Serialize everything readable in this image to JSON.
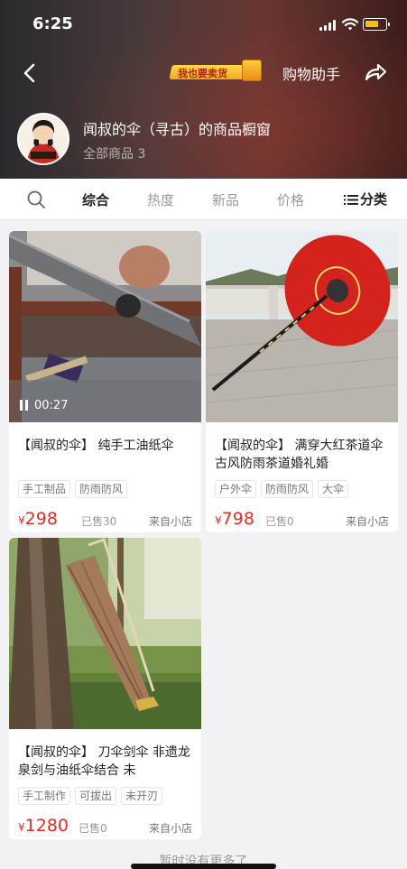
{
  "status_bar": {
    "time": "6:25"
  },
  "nav": {
    "sell_badge": "我也要卖货",
    "assistant": "购物助手"
  },
  "shop": {
    "name": "闻叔的伞（寻古）的商品橱窗",
    "count_label": "全部商品 3",
    "avatar_text": "闻叔的伞"
  },
  "tabs": [
    {
      "label": "综合",
      "active": true
    },
    {
      "label": "热度",
      "active": false
    },
    {
      "label": "新品",
      "active": false
    },
    {
      "label": "价格",
      "active": false
    }
  ],
  "category_label": "分类",
  "products": [
    {
      "title": "【闻叔的伞】 纯手工油纸伞",
      "tags": [
        "手工制品",
        "防雨防风"
      ],
      "currency": "¥",
      "price": "298",
      "sold": "已售30",
      "source": "来自小店",
      "video_duration": "00:27"
    },
    {
      "title": "【闻叔的伞】 满穿大红茶道伞 古风防雨茶道婚礼婚",
      "tags": [
        "户外伞",
        "防雨防风",
        "大伞"
      ],
      "currency": "¥",
      "price": "798",
      "sold": "已售0",
      "source": "来自小店"
    },
    {
      "title": "【闻叔的伞】 刀伞剑伞 非遗龙泉剑与油纸伞结合 未",
      "tags": [
        "手工制作",
        "可拔出",
        "未开刃"
      ],
      "currency": "¥",
      "price": "1280",
      "sold": "已售0",
      "source": "来自小店"
    }
  ],
  "footer": {
    "no_more": "暂时没有更多了"
  },
  "colors": {
    "price": "#e02e24",
    "accent_badge": "#f4a81d",
    "header_dark": "#2a2a2d",
    "header_red": "#6a3632"
  }
}
